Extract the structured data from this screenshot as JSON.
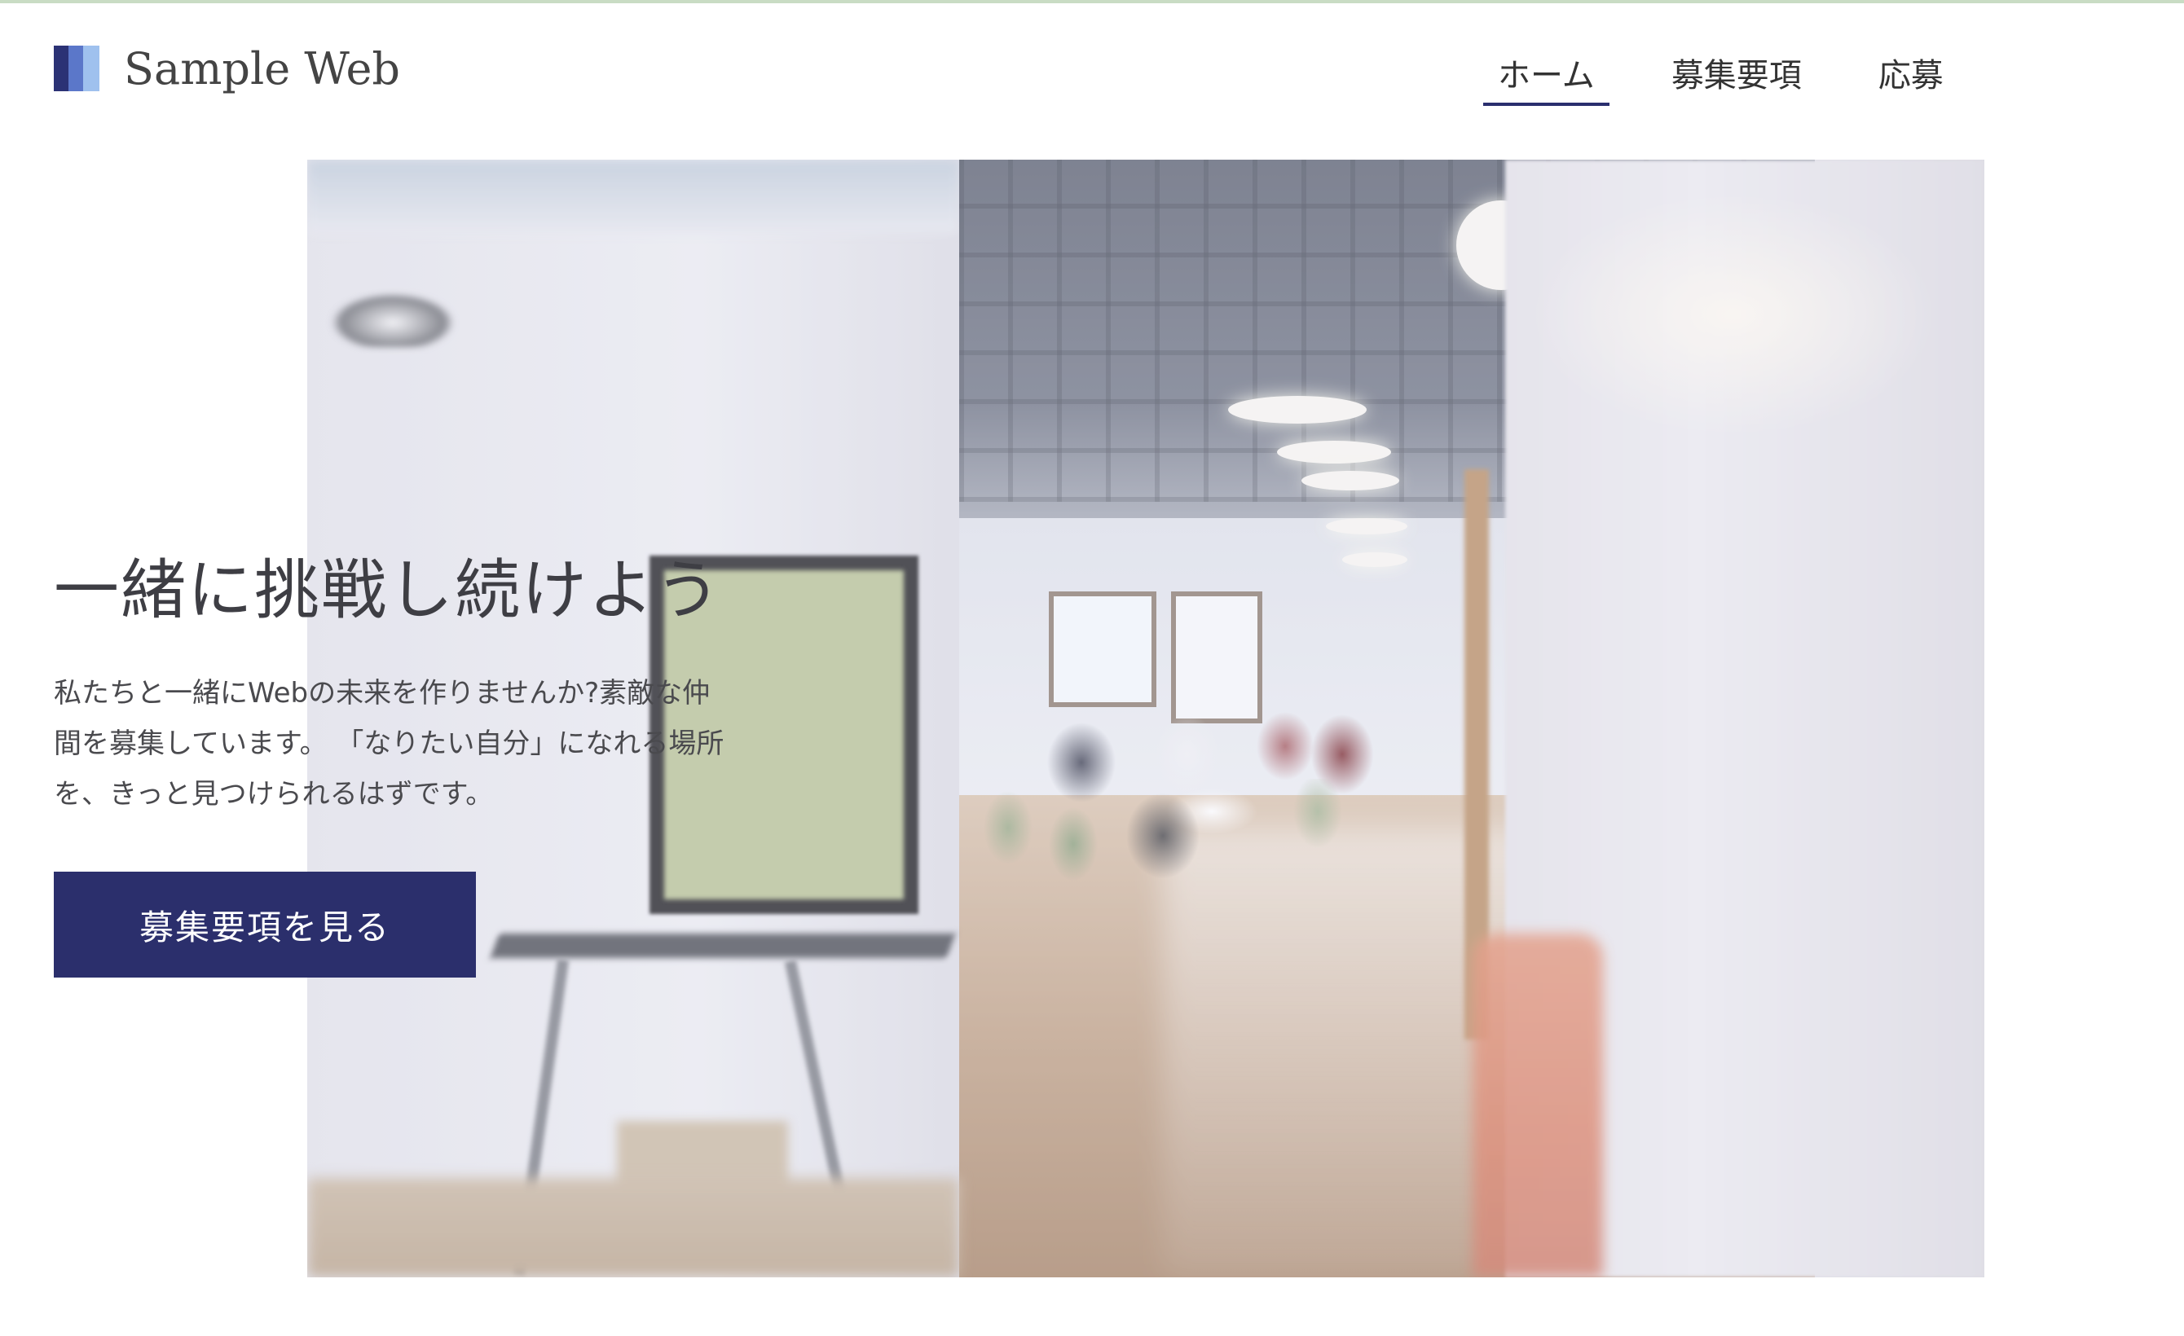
{
  "header": {
    "logo_text": "Sample Web",
    "nav": [
      {
        "label": "ホーム",
        "active": true
      },
      {
        "label": "募集要項",
        "active": false
      },
      {
        "label": "応募",
        "active": false
      }
    ]
  },
  "hero": {
    "title": "一緒に挑戦し続けよう",
    "body_lines": [
      "私たちと一緒にWebの未来を作りませんか?素敵な仲",
      "間を募集しています。 「なりたい自分」になれる場所",
      "を、きっと見つけられるはずです。"
    ],
    "cta_label": "募集要項を見る"
  },
  "colors": {
    "accent": "#2b2f6c",
    "top_line": "#c9dcc4",
    "logo_dark": "#2b3275",
    "logo_mid": "#5b77c9",
    "logo_light": "#9fc1ee"
  },
  "icons": {
    "logo": "striped-square-logo-icon"
  }
}
